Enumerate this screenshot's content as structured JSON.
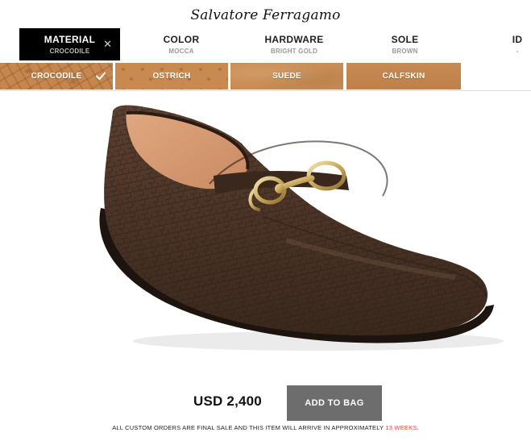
{
  "brand": {
    "logo_text": "Salvatore Ferragamo"
  },
  "tabs": [
    {
      "label": "MATERIAL",
      "value": "CROCODILE",
      "active": true
    },
    {
      "label": "COLOR",
      "value": "MOCCA"
    },
    {
      "label": "HARDWARE",
      "value": "BRIGHT GOLD"
    },
    {
      "label": "SOLE",
      "value": "BROWN"
    },
    {
      "label": "ID",
      "value": "-"
    }
  ],
  "materials": [
    {
      "label": "CROCODILE",
      "selected": true
    },
    {
      "label": "OSTRICH"
    },
    {
      "label": "SUEDE"
    },
    {
      "label": "CALFSKIN"
    }
  ],
  "icons": {
    "close": "close-icon",
    "check": "checkmark-icon"
  },
  "product": {
    "image": "brown-crocodile-driving-loafer-with-gold-gancini-bit",
    "price": "USD 2,400",
    "add_to_bag": "ADD TO BAG"
  },
  "notice": {
    "prefix": "ALL CUSTOM ORDERS ARE FINAL SALE AND THIS ITEM WILL ARRIVE IN APPROXIMATELY ",
    "highlight": "13 WEEKS",
    "suffix": "."
  },
  "colors": {
    "active_tab_bg": "#000000",
    "button_bg": "#6d6d6d",
    "highlight": "#e2463b",
    "swatch_base": "#c68a52"
  }
}
